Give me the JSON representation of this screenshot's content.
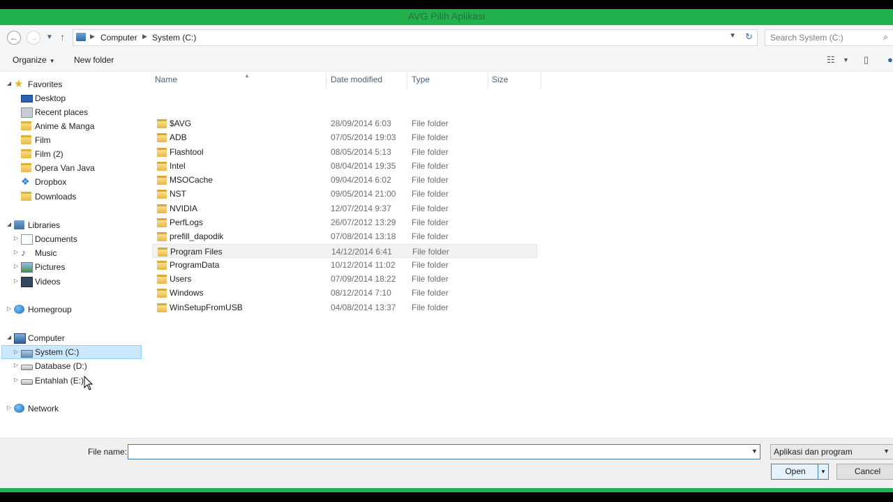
{
  "window": {
    "title": "AVG Pilih Aplikasi"
  },
  "address": {
    "crumbs": [
      "Computer",
      "System (C:)"
    ],
    "search_placeholder": "Search System (C:)"
  },
  "toolbar": {
    "organize": "Organize",
    "new_folder": "New folder"
  },
  "nav": {
    "favorites": {
      "label": "Favorites",
      "items": [
        "Desktop",
        "Recent places",
        "Anime & Manga",
        "Film",
        "Film (2)",
        "Opera Van Java",
        "Dropbox",
        "Downloads"
      ]
    },
    "libraries": {
      "label": "Libraries",
      "items": [
        "Documents",
        "Music",
        "Pictures",
        "Videos"
      ]
    },
    "homegroup": "Homegroup",
    "computer": {
      "label": "Computer",
      "items": [
        "System (C:)",
        "Database (D:)",
        "Entahlah (E:)"
      ]
    },
    "network": "Network"
  },
  "columns": {
    "name": "Name",
    "date": "Date modified",
    "type": "Type",
    "size": "Size"
  },
  "files": [
    {
      "name": "$AVG",
      "date": "28/09/2014 6:03",
      "type": "File folder"
    },
    {
      "name": "ADB",
      "date": "07/05/2014 19:03",
      "type": "File folder"
    },
    {
      "name": "Flashtool",
      "date": "08/05/2014 5:13",
      "type": "File folder"
    },
    {
      "name": "Intel",
      "date": "08/04/2014 19:35",
      "type": "File folder"
    },
    {
      "name": "MSOCache",
      "date": "09/04/2014 6:02",
      "type": "File folder"
    },
    {
      "name": "NST",
      "date": "09/05/2014 21:00",
      "type": "File folder"
    },
    {
      "name": "NVIDIA",
      "date": "12/07/2014 9:37",
      "type": "File folder"
    },
    {
      "name": "PerfLogs",
      "date": "26/07/2012 13:29",
      "type": "File folder"
    },
    {
      "name": "prefill_dapodik",
      "date": "07/08/2014 13:18",
      "type": "File folder"
    },
    {
      "name": "Program Files",
      "date": "14/12/2014 6:41",
      "type": "File folder"
    },
    {
      "name": "ProgramData",
      "date": "10/12/2014 11:02",
      "type": "File folder"
    },
    {
      "name": "Users",
      "date": "07/09/2014 18:22",
      "type": "File folder"
    },
    {
      "name": "Windows",
      "date": "08/12/2014 7:10",
      "type": "File folder"
    },
    {
      "name": "WinSetupFromUSB",
      "date": "04/08/2014 13:37",
      "type": "File folder"
    }
  ],
  "bottom": {
    "file_name_label": "File name:",
    "file_name_value": "",
    "filter": "Aplikasi dan program",
    "open": "Open",
    "cancel": "Cancel"
  }
}
